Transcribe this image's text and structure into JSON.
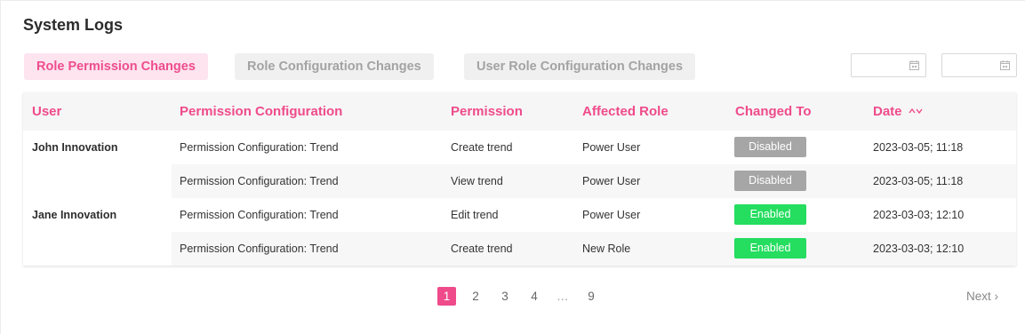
{
  "page": {
    "title": "System Logs"
  },
  "tabs": [
    {
      "label": "Role Permission Changes",
      "active": true
    },
    {
      "label": "Role Configuration Changes",
      "active": false
    },
    {
      "label": "User Role Configuration Changes",
      "active": false
    }
  ],
  "filters": {
    "date_from": {
      "value": "",
      "icon": "calendar-icon"
    },
    "date_to": {
      "value": "",
      "icon": "calendar-icon"
    }
  },
  "table": {
    "headers": [
      "User",
      "Permission Configuration",
      "Permission",
      "Affected Role",
      "Changed To",
      "Date"
    ],
    "rows": [
      {
        "user": "John Innovation",
        "config": "Permission Configuration: Trend",
        "permission": "Create trend",
        "role": "Power User",
        "changed_to": "Disabled",
        "date": "2023-03-05; 11:18"
      },
      {
        "user": "",
        "config": "Permission Configuration: Trend",
        "permission": "View trend",
        "role": "Power User",
        "changed_to": "Disabled",
        "date": "2023-03-05; 11:18"
      },
      {
        "user": "Jane Innovation",
        "config": "Permission Configuration: Trend",
        "permission": "Edit trend",
        "role": "Power User",
        "changed_to": "Enabled",
        "date": "2023-03-03; 12:10"
      },
      {
        "user": "",
        "config": "Permission Configuration: Trend",
        "permission": "Create trend",
        "role": "New Role",
        "changed_to": "Enabled",
        "date": "2023-03-03; 12:10"
      }
    ]
  },
  "pagination": {
    "pages": [
      "1",
      "2",
      "3",
      "4",
      "9"
    ],
    "current": "1",
    "ellipsis": "…",
    "next_label": "Next ›"
  },
  "colors": {
    "accent": "#ef4b8b",
    "enabled": "#25dd5f",
    "disabled": "#a6a6a6"
  }
}
